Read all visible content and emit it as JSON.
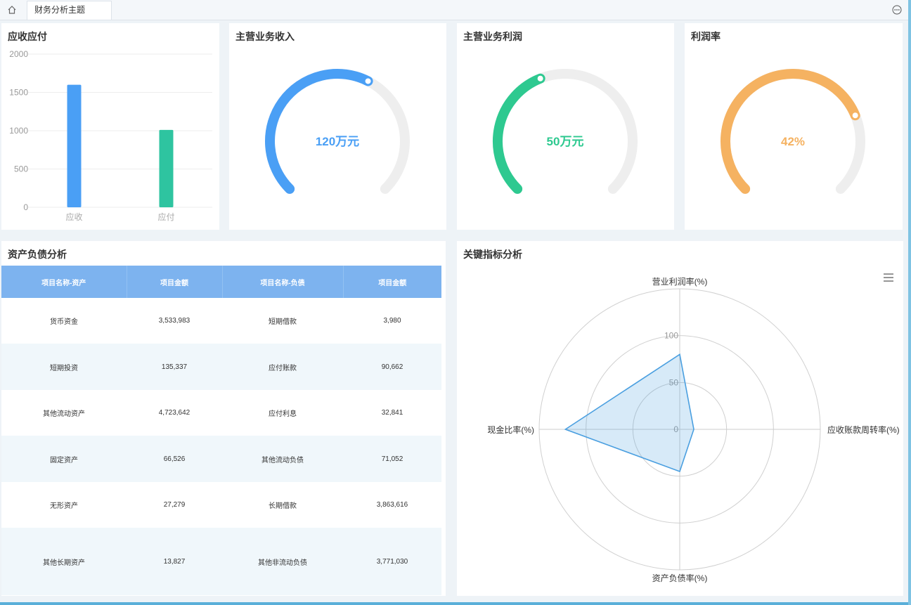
{
  "tabbar": {
    "tab_label": "财务分析主题",
    "home_icon": "home-icon",
    "more_icon": "more-options-icon"
  },
  "ar_ap": {
    "title": "应收应付",
    "chart_data": {
      "type": "bar",
      "categories": [
        "应收",
        "应付"
      ],
      "values": [
        1600,
        1010
      ],
      "colors": [
        "#4a9ff5",
        "#2ec4a0"
      ],
      "ylim": [
        0,
        2000
      ],
      "yticks": [
        0,
        500,
        1000,
        1500,
        2000
      ],
      "grid": true
    }
  },
  "gauges": [
    {
      "title": "主营业务收入",
      "value_text": "120万元",
      "fraction": 0.6,
      "color": "#4a9ff5"
    },
    {
      "title": "主营业务利润",
      "value_text": "50万元",
      "fraction": 0.42,
      "color": "#2ec990"
    },
    {
      "title": "利润率",
      "value_text": "42%",
      "fraction": 0.75,
      "color": "#f5b261"
    }
  ],
  "balance": {
    "title": "资产负债分析",
    "headers": [
      "项目名称-资产",
      "项目金额",
      "项目名称-负债",
      "项目金额"
    ],
    "rows": [
      [
        "货币资金",
        "3,533,983",
        "短期借款",
        "3,980"
      ],
      [
        "短期投资",
        "135,337",
        "应付账款",
        "90,662"
      ],
      [
        "其他流动资产",
        "4,723,642",
        "应付利息",
        "32,841"
      ],
      [
        "固定资产",
        "66,526",
        "其他流动负债",
        "71,052"
      ],
      [
        "无形资产",
        "27,279",
        "长期借款",
        "3,863,616"
      ],
      [
        "其他长期资产",
        "13,827",
        "其他非流动负债",
        "3,771,030"
      ]
    ]
  },
  "kpi": {
    "title": "关键指标分析",
    "menu_icon": "hamburger-menu-icon",
    "chart_data": {
      "type": "radar",
      "indicators": [
        "营业利润率(%)",
        "应收账款周转率(%)",
        "资产负债率(%)",
        "现金比率(%)"
      ],
      "values": [
        80,
        15,
        45,
        122
      ],
      "ticks": [
        0,
        50,
        100
      ],
      "color": "#4a9fe0"
    }
  }
}
